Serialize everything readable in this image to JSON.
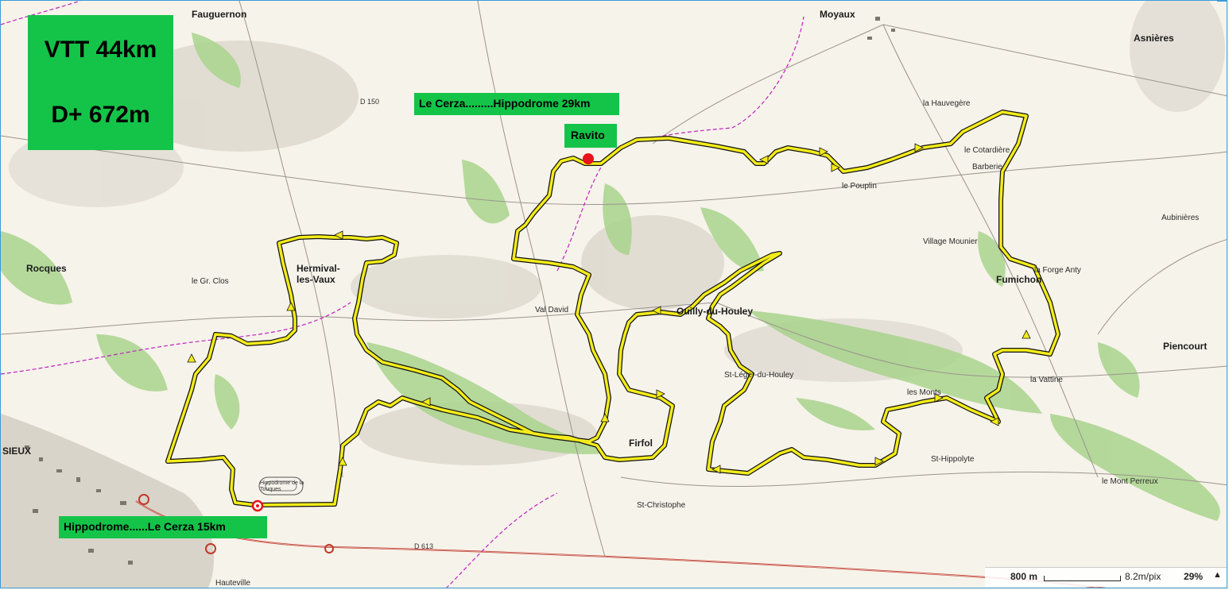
{
  "title_box": {
    "line1": "VTT 44km",
    "line2": "D+ 672m"
  },
  "route_labels": {
    "top": "Le Cerza.........Hippodrome 29km",
    "bottom": "Hippodrome......Le Cerza 15km",
    "ravito": "Ravito"
  },
  "places": [
    {
      "id": "moyaux",
      "text": "Moyaux",
      "big": true
    },
    {
      "id": "fauguernon",
      "text": "Fauguernon",
      "big": true
    },
    {
      "id": "asnieres",
      "text": "Asnières",
      "big": true
    },
    {
      "id": "rocques",
      "text": "Rocques",
      "big": true
    },
    {
      "id": "hermival",
      "text": "Hermival-les-Vaux",
      "big": true
    },
    {
      "id": "ouilly",
      "text": "Ouilly-du-Houley",
      "big": true
    },
    {
      "id": "fumichon",
      "text": "Fumichon",
      "big": true
    },
    {
      "id": "firfol",
      "text": "Firfol",
      "big": true
    },
    {
      "id": "piencourt",
      "text": "Piencourt",
      "big": true
    },
    {
      "id": "aubinieres",
      "text": "Aubinières",
      "big": false
    },
    {
      "id": "lieux",
      "text": "SIEUX",
      "big": true
    },
    {
      "id": "le-pouplin",
      "text": "le Pouplin",
      "big": false
    },
    {
      "id": "st-hippolyte",
      "text": "St-Hippolyte",
      "big": false
    },
    {
      "id": "st-leger",
      "text": "St-Léger-du-Houley",
      "big": false
    },
    {
      "id": "le-mont-perreux",
      "text": "le Mont Perreux",
      "big": false
    },
    {
      "id": "la-hauvegere",
      "text": "la Hauvegère",
      "big": false
    },
    {
      "id": "village-mounier",
      "text": "Village Mounier",
      "big": false
    },
    {
      "id": "le-cotardiere",
      "text": "le Cotardière",
      "big": false
    },
    {
      "id": "la-barberie",
      "text": "Barberie",
      "big": false
    },
    {
      "id": "hauteville",
      "text": "Hauteville",
      "big": false
    },
    {
      "id": "st-christophe",
      "text": "St-Christophe",
      "big": false
    },
    {
      "id": "la-vattine",
      "text": "la Vattine",
      "big": false
    },
    {
      "id": "les-monts",
      "text": "les Monts",
      "big": false
    },
    {
      "id": "la-forge-anty",
      "text": "la Forge Anty",
      "big": false
    },
    {
      "id": "le-val-david",
      "text": "Val David",
      "big": false
    },
    {
      "id": "le-gr-clos",
      "text": "le Gr. Clos",
      "big": false
    },
    {
      "id": "d613",
      "text": "D 613",
      "big": false
    },
    {
      "id": "d150",
      "text": "D 150",
      "big": false
    },
    {
      "id": "hippodrome-map",
      "text": "Hippodrome de la Touques",
      "big": false
    }
  ],
  "scale": {
    "distance": "800 m",
    "resolution": "8.2m/pix",
    "zoom": "29%",
    "collapse_icon": "▲"
  },
  "colors": {
    "route": "#f4ec1a",
    "route_outline": "#111111",
    "label_bg": "#14c449",
    "forest": "#a9d38d",
    "road_main": "#c0392b",
    "trail": "#c020c0",
    "ravito_dot": "#e8131b",
    "start_marker": "#e8131b"
  }
}
